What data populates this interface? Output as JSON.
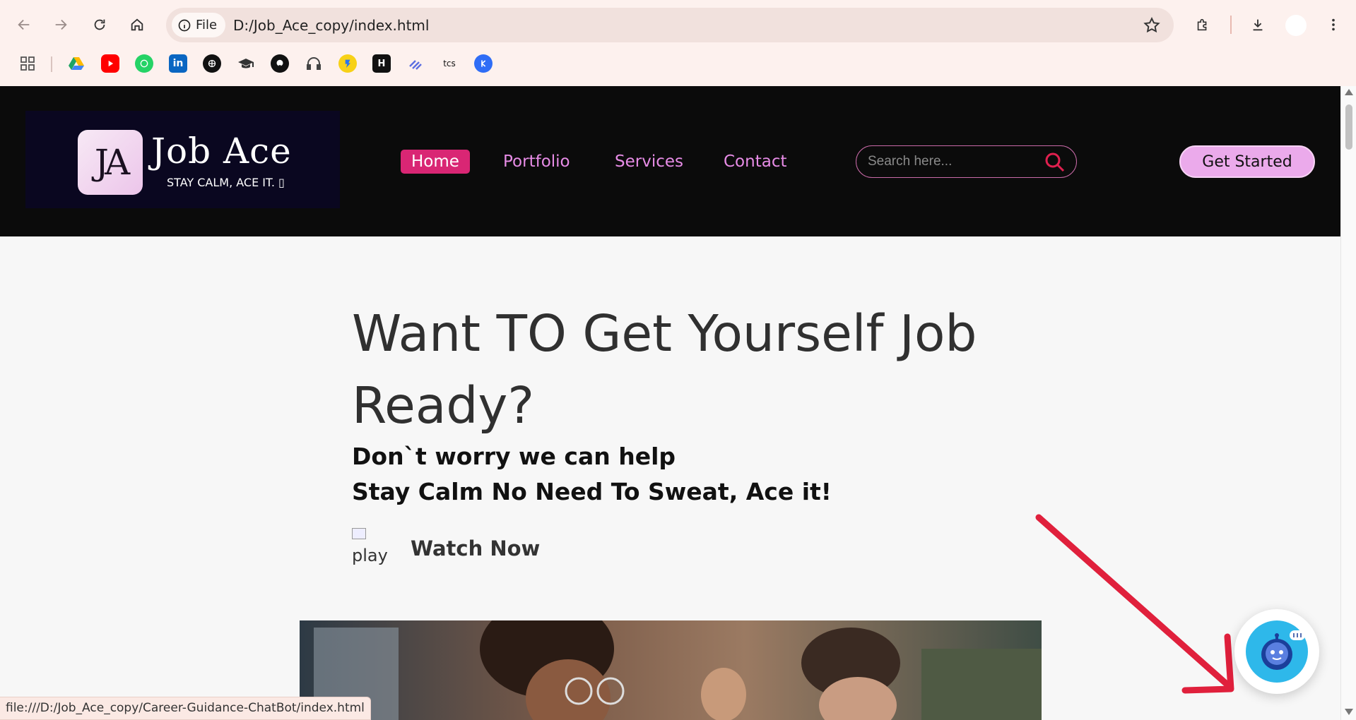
{
  "browser": {
    "url": "D:/Job_Ace_copy/index.html",
    "scheme_label": "File",
    "status_url": "file:///D:/Job_Ace_copy/Career-Guidance-ChatBot/index.html",
    "bookmarks": [
      {
        "icon": "apps-grid-icon"
      },
      {
        "icon": "google-drive-icon",
        "color": "#1fa463"
      },
      {
        "icon": "youtube-icon",
        "color": "#ff0000"
      },
      {
        "icon": "whatsapp-icon",
        "color": "#25d366"
      },
      {
        "icon": "linkedin-icon",
        "color": "#0a66c2"
      },
      {
        "icon": "chatgpt-icon",
        "color": "#111111"
      },
      {
        "icon": "graduation-cap-icon",
        "color": "#333333"
      },
      {
        "icon": "github-icon",
        "color": "#111111"
      },
      {
        "icon": "headset-icon",
        "color": "#444444"
      },
      {
        "icon": "flipkart-icon",
        "color": "#f7d117"
      },
      {
        "icon": "hackerearth-icon",
        "color": "#111111",
        "text": "H"
      },
      {
        "icon": "stack-icon",
        "color": "#5b6ee1"
      },
      {
        "icon": "tcs-icon",
        "color": "#111111",
        "text": "tcs"
      },
      {
        "icon": "blue-k-icon",
        "color": "#2f6df6"
      }
    ]
  },
  "site": {
    "logo": {
      "mark": "JA",
      "title": "Job Ace",
      "tagline": "STAY CALM, ACE IT. ▯"
    },
    "nav": [
      {
        "label": "Home",
        "active": true
      },
      {
        "label": "Portfolio",
        "active": false
      },
      {
        "label": "Services",
        "active": false
      },
      {
        "label": "Contact",
        "active": false
      }
    ],
    "search": {
      "placeholder": "Search here..."
    },
    "cta_label": "Get Started",
    "hero": {
      "title": "Want TO Get Yourself Job Ready?",
      "line1": "Don`t worry we can help",
      "line2": "Stay Calm No Need To Sweat, Ace it!",
      "play_alt": "play",
      "watch_label": "Watch Now"
    },
    "colors": {
      "nav_bg": "#0b0b0b",
      "accent": "#d92674",
      "link": "#e78ce6",
      "cta": "#ebaaeb",
      "arrow": "#e0203c",
      "chatbot": "#2eb8ea"
    }
  }
}
